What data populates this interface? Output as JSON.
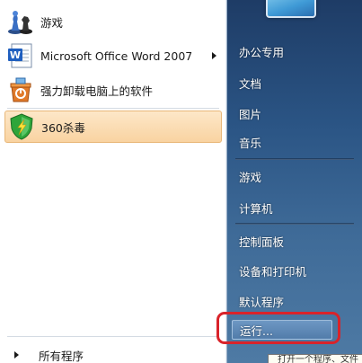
{
  "programs": [
    {
      "label": "游戏",
      "icon": "games-chess-icon"
    },
    {
      "label": "Microsoft Office Word 2007",
      "icon": "word-icon",
      "has_submenu": true
    },
    {
      "label": "强力卸载电脑上的软件",
      "icon": "uninstaller-icon"
    },
    {
      "label": "360杀毒",
      "icon": "antivirus-shield-icon",
      "highlighted": true
    }
  ],
  "all_programs_label": "所有程序",
  "right_pane": {
    "items": [
      {
        "label": "办公专用"
      },
      {
        "label": "文档"
      },
      {
        "label": "图片"
      },
      {
        "label": "音乐"
      },
      {
        "label": "游戏"
      },
      {
        "label": "计算机"
      },
      {
        "label": "控制面板"
      },
      {
        "label": "设备和打印机"
      },
      {
        "label": "默认程序"
      }
    ],
    "run_label": "运行..."
  },
  "tooltip_text": "打开一个程序、文件"
}
